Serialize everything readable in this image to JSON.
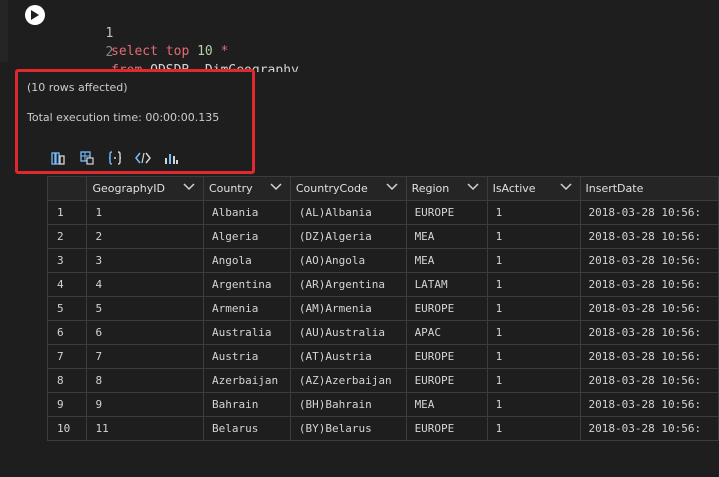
{
  "editor": {
    "lines": [
      {
        "number": "1",
        "tokens": [
          {
            "text": "select ",
            "kind": "kw"
          },
          {
            "text": "top ",
            "kind": "kw"
          },
          {
            "text": "10 ",
            "kind": "num"
          },
          {
            "text": "*",
            "kind": "kw"
          }
        ]
      },
      {
        "number": "2",
        "tokens": [
          {
            "text": "from ",
            "kind": "kw"
          },
          {
            "text": "ODSDB..DimGeography",
            "kind": "id"
          }
        ]
      }
    ],
    "line1_text": "select top 10 *",
    "line2_kw": "from",
    "line2_id": "ODSDB..DimGeography"
  },
  "messages": {
    "rows_affected": "(10 rows affected)",
    "execution_time": "Total execution time: 00:00:00.135"
  },
  "toolbar": {
    "icons": [
      "save-csv-icon",
      "save-excel-icon",
      "save-json-icon",
      "save-xml-icon",
      "chart-icon"
    ]
  },
  "results": {
    "columns": [
      "GeographyID",
      "Country",
      "CountryCode",
      "Region",
      "IsActive",
      "InsertDate"
    ],
    "rows": [
      [
        "1",
        "1",
        "Albania",
        "(AL)Albania",
        "EUROPE",
        "1",
        "2018-03-28 10:56:"
      ],
      [
        "2",
        "2",
        "Algeria",
        "(DZ)Algeria",
        "MEA",
        "1",
        "2018-03-28 10:56:"
      ],
      [
        "3",
        "3",
        "Angola",
        "(AO)Angola",
        "MEA",
        "1",
        "2018-03-28 10:56:"
      ],
      [
        "4",
        "4",
        "Argentina",
        "(AR)Argentina",
        "LATAM",
        "1",
        "2018-03-28 10:56:"
      ],
      [
        "5",
        "5",
        "Armenia",
        "(AM)Armenia",
        "EUROPE",
        "1",
        "2018-03-28 10:56:"
      ],
      [
        "6",
        "6",
        "Australia",
        "(AU)Australia",
        "APAC",
        "1",
        "2018-03-28 10:56:"
      ],
      [
        "7",
        "7",
        "Austria",
        "(AT)Austria",
        "EUROPE",
        "1",
        "2018-03-28 10:56:"
      ],
      [
        "8",
        "8",
        "Azerbaijan",
        "(AZ)Azerbaijan",
        "EUROPE",
        "1",
        "2018-03-28 10:56:"
      ],
      [
        "9",
        "9",
        "Bahrain",
        "(BH)Bahrain",
        "MEA",
        "1",
        "2018-03-28 10:56:"
      ],
      [
        "10",
        "11",
        "Belarus",
        "(BY)Belarus",
        "EUROPE",
        "1",
        "2018-03-28 10:56:"
      ]
    ]
  },
  "colors": {
    "background": "#1e1e1e",
    "keyword": "#e06c75",
    "number": "#b5cea8",
    "highlight_border": "#e0282e",
    "toolbar_icon": "#75beff"
  }
}
